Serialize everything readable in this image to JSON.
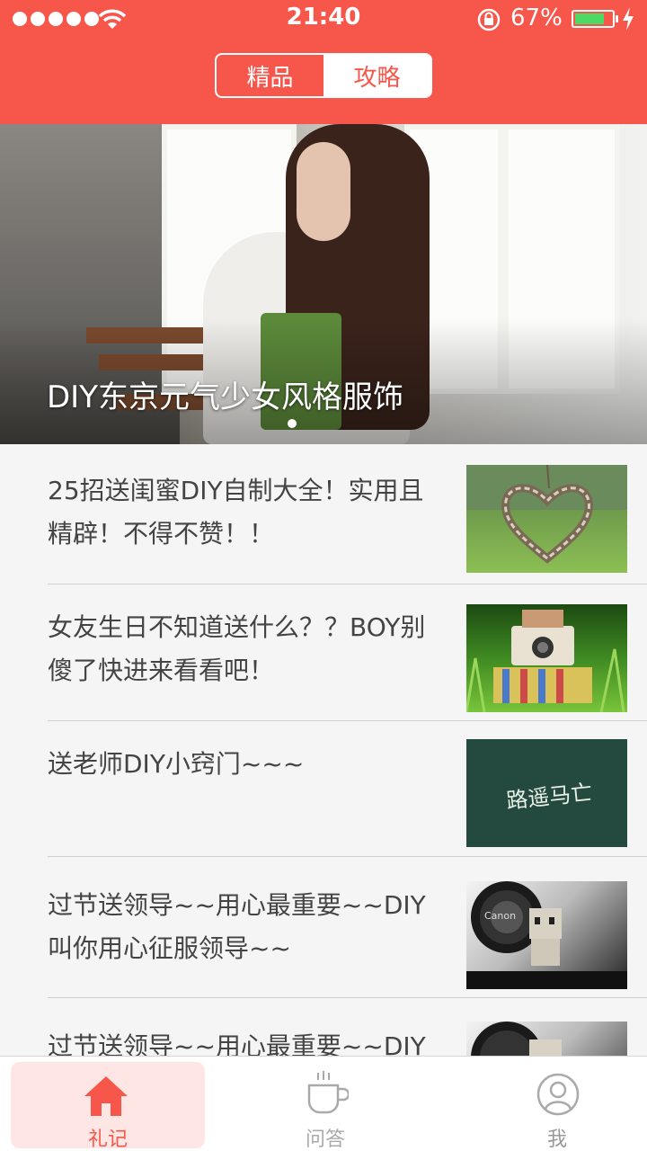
{
  "status_bar": {
    "time": "21:40",
    "battery_percent": "67%"
  },
  "segmented_control": {
    "left_label": "精品",
    "right_label": "攻略",
    "selected": "攻略"
  },
  "banner": {
    "title": "DIY东京元气少女风格服饰"
  },
  "articles": [
    {
      "title": "25招送闺蜜DIY自制大全！实用且精辟！不得不赞！！",
      "thumb_icon": "heart-wreath-photo"
    },
    {
      "title": "女友生日不知道送什么？？BOY别傻了快进来看看吧！",
      "thumb_icon": "camera-grass-photo"
    },
    {
      "title": "送老师DIY小窍门~~~",
      "thumb_icon": "chalkboard-photo",
      "board_text": "路遥马亡"
    },
    {
      "title": "过节送领导~~用心最重要~~DIY叫你用心征服领导~~",
      "thumb_icon": "canon-lens-photo",
      "lens_text": "Canon"
    },
    {
      "title": "过节送领导~~用心最重要~~DIY",
      "thumb_icon": "canon-lens-photo"
    }
  ],
  "tab_bar": {
    "items": [
      {
        "label": "礼记",
        "icon": "home-icon",
        "active": true
      },
      {
        "label": "问答",
        "icon": "cup-icon",
        "active": false
      },
      {
        "label": "我",
        "icon": "user-icon",
        "active": false
      }
    ]
  },
  "colors": {
    "brand": "#f7564a",
    "battery": "#4cd964"
  }
}
